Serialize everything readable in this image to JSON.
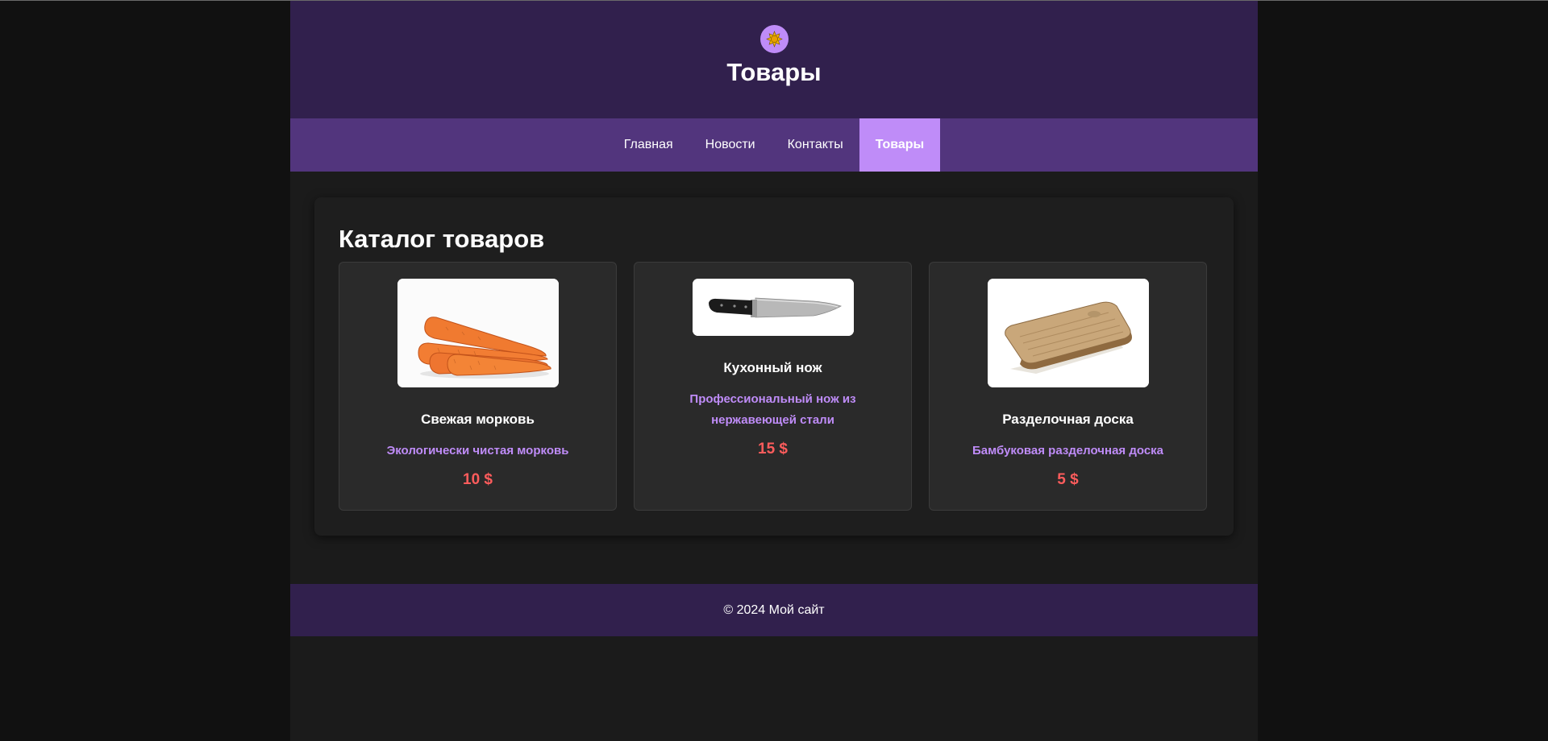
{
  "header": {
    "title": "Товары",
    "logo_icon": "sun-flower-icon"
  },
  "nav": {
    "items": [
      {
        "label": "Главная",
        "active": false
      },
      {
        "label": "Новости",
        "active": false
      },
      {
        "label": "Контакты",
        "active": false
      },
      {
        "label": "Товары",
        "active": true
      }
    ]
  },
  "main": {
    "catalog_title": "Каталог товаров",
    "products": [
      {
        "name": "Свежая морковь",
        "description": "Экологически чистая морковь",
        "price": "10 $",
        "image": "carrots-photo"
      },
      {
        "name": "Кухонный нож",
        "description": "Профессиональный нож из нержавеющей стали",
        "price": "15 $",
        "image": "kitchen-knife-photo"
      },
      {
        "name": "Разделочная доска",
        "description": "Бамбуковая разделочная доска",
        "price": "5 $",
        "image": "cutting-board-photo"
      }
    ]
  },
  "footer": {
    "text": "© 2024 Мой сайт"
  },
  "colors": {
    "header_bg": "#31204d",
    "nav_bg": "#52357d",
    "accent": "#bf8cf8",
    "price": "#ff5c5c",
    "page_bg": "#1b1b1b"
  }
}
